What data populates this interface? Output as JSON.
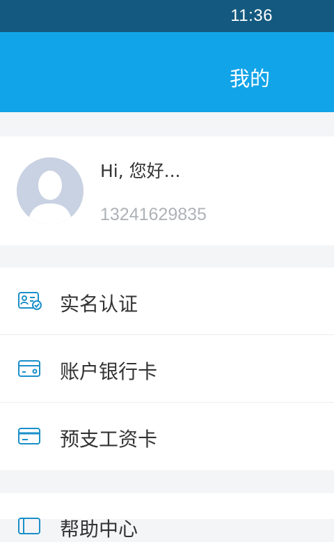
{
  "status_bar": {
    "time": "11:36"
  },
  "header": {
    "title": "我的"
  },
  "profile": {
    "greeting": "Hi, 您好...",
    "phone": "13241629835",
    "avatar_icon": "user-avatar-icon"
  },
  "menu": {
    "items": [
      {
        "label": "实名认证",
        "icon": "id-verify-icon"
      },
      {
        "label": "账户银行卡",
        "icon": "bank-card-icon"
      },
      {
        "label": "预支工资卡",
        "icon": "salary-card-icon"
      }
    ],
    "items2": [
      {
        "label": "帮助中心",
        "icon": "help-icon"
      }
    ]
  },
  "colors": {
    "status_bar": "#14597f",
    "header": "#12a4e8",
    "icon_accent": "#1a8fc9",
    "background": "#f4f5f7"
  }
}
